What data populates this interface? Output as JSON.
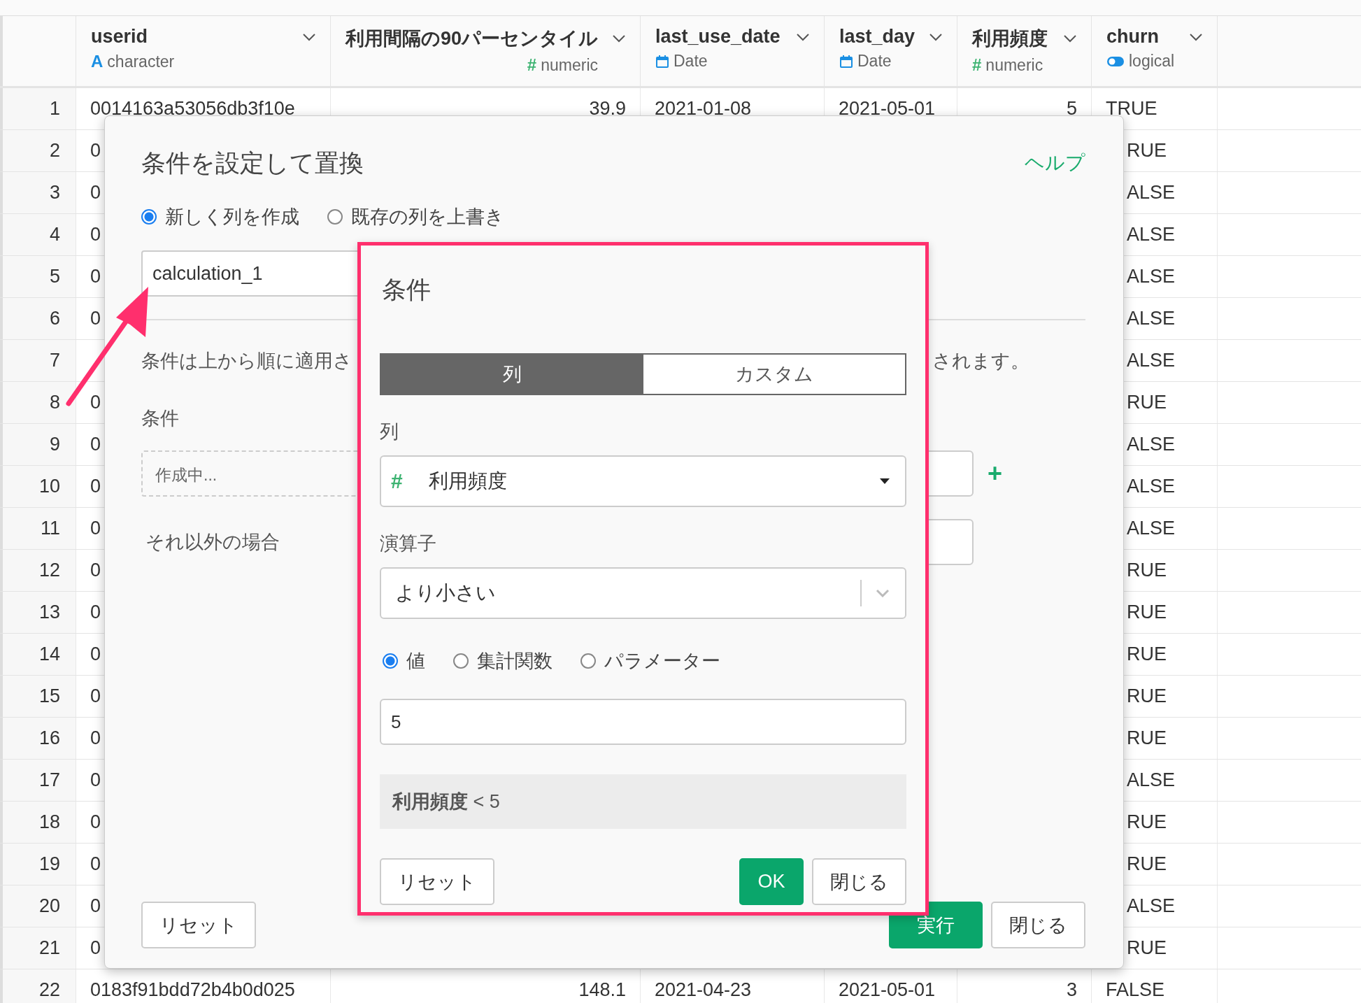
{
  "columns": [
    {
      "name": "userid",
      "type": "character",
      "kind": "text",
      "glyph": "A"
    },
    {
      "name": "利用間隔の90パーセンタイル",
      "type": "numeric",
      "kind": "text",
      "glyph": "#"
    },
    {
      "name": "last_use_date",
      "type": "Date",
      "kind": "date"
    },
    {
      "name": "last_day",
      "type": "Date",
      "kind": "date"
    },
    {
      "name": "利用頻度",
      "type": "numeric",
      "kind": "text",
      "glyph": "#"
    },
    {
      "name": "churn",
      "type": "logical",
      "kind": "logical"
    }
  ],
  "rows": [
    {
      "num": "1",
      "userid": "0014163a53056db3f10e",
      "percentile": "39.9",
      "last_use_date": "2021-01-08",
      "last_day": "2021-05-01",
      "freq": "5",
      "churn": "TRUE"
    },
    {
      "num": "2",
      "userid": "0",
      "churn": "RUE"
    },
    {
      "num": "3",
      "userid": "0",
      "churn": "ALSE"
    },
    {
      "num": "4",
      "userid": "0",
      "churn": "ALSE"
    },
    {
      "num": "5",
      "userid": "0",
      "churn": "ALSE"
    },
    {
      "num": "6",
      "userid": "0",
      "churn": "ALSE"
    },
    {
      "num": "7",
      "churn": "ALSE"
    },
    {
      "num": "8",
      "userid": "0",
      "churn": "RUE"
    },
    {
      "num": "9",
      "userid": "0",
      "churn": "ALSE"
    },
    {
      "num": "10",
      "userid": "0",
      "churn": "ALSE"
    },
    {
      "num": "11",
      "userid": "0",
      "churn": "ALSE"
    },
    {
      "num": "12",
      "userid": "0",
      "churn": "RUE"
    },
    {
      "num": "13",
      "userid": "0",
      "churn": "RUE"
    },
    {
      "num": "14",
      "userid": "0",
      "churn": "RUE"
    },
    {
      "num": "15",
      "userid": "0",
      "churn": "RUE"
    },
    {
      "num": "16",
      "userid": "0",
      "churn": "RUE"
    },
    {
      "num": "17",
      "userid": "0",
      "churn": "ALSE"
    },
    {
      "num": "18",
      "userid": "0",
      "churn": "RUE"
    },
    {
      "num": "19",
      "userid": "0",
      "churn": "RUE"
    },
    {
      "num": "20",
      "userid": "0",
      "churn": "ALSE"
    },
    {
      "num": "21",
      "userid": "0",
      "churn": "RUE"
    },
    {
      "num": "22",
      "userid": "0183f91bdd72b4b0d025",
      "percentile": "148.1",
      "last_use_date": "2021-04-23",
      "last_day": "2021-05-01",
      "freq": "3",
      "churn": "FALSE"
    }
  ],
  "dialog": {
    "title": "条件を設定して置換",
    "help": "ヘルプ",
    "modes": [
      {
        "label": "新しく列を作成",
        "selected": true
      },
      {
        "label": "既存の列を上書き",
        "selected": false
      }
    ],
    "name_value": "calculation_1",
    "note_start": "条件は上から順に適用さ",
    "note_end": "されます。",
    "conditions_label": "条件",
    "condition_text": "作成中...",
    "add": "+",
    "else_label": "それ以外の場合",
    "reset": "リセット",
    "run": "実行",
    "close": "閉じる"
  },
  "popup": {
    "title": "条件",
    "tabs": [
      {
        "label": "列",
        "selected": true
      },
      {
        "label": "カスタム",
        "selected": false
      }
    ],
    "column_label": "列",
    "column_glyph": "#",
    "column_value": "利用頻度",
    "operator_label": "演算子",
    "operator_value": "より小さい",
    "value_types": [
      {
        "label": "値",
        "selected": true
      },
      {
        "label": "集計関数",
        "selected": false
      },
      {
        "label": "パラメーター",
        "selected": false
      }
    ],
    "value": "5",
    "preview": "**利用頻度** < 5",
    "reset": "リセット",
    "ok": "OK",
    "close": "閉じる"
  }
}
